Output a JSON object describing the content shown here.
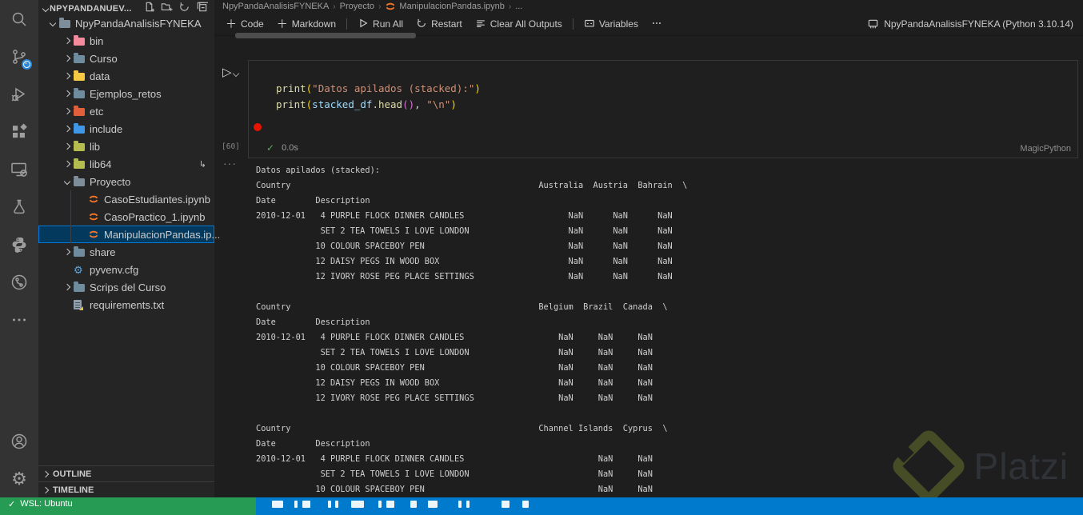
{
  "window": {
    "watermark_text": "Platzi"
  },
  "colors": {
    "accent_blue": "#007acc",
    "selection_bg": "#04395e",
    "selection_border": "#0078d4",
    "jupyter_orange": "#f37626",
    "remote_green": "#259b53",
    "breakpoint_red": "#e51400"
  },
  "activity_bar": {
    "icons": [
      "search",
      "source-control",
      "run-and-debug",
      "extensions",
      "remote-explorer",
      "testing",
      "python",
      "gitlens",
      "more-views",
      "account",
      "settings"
    ],
    "source_control_badge": "pending-clock"
  },
  "sidebar": {
    "header": {
      "title": "NPYPANDANUEV...",
      "actions": [
        "new-file",
        "new-folder",
        "refresh-explorer",
        "collapse-folders"
      ]
    },
    "tree": [
      {
        "label": "NpyPandaAnalisisFYNEKA",
        "type": "folder",
        "color": "#7d8d99",
        "level": 0,
        "expanded": true
      },
      {
        "label": "bin",
        "type": "folder",
        "color": "#f48b9d",
        "level": 1
      },
      {
        "label": "Curso",
        "type": "folder",
        "color": "#6f8b9e",
        "level": 1
      },
      {
        "label": "data",
        "type": "folder",
        "color": "#f6c944",
        "level": 1
      },
      {
        "label": "Ejemplos_retos",
        "type": "folder",
        "color": "#6f8b9e",
        "level": 1
      },
      {
        "label": "etc",
        "type": "folder",
        "color": "#e25f3b",
        "level": 1
      },
      {
        "label": "include",
        "type": "folder",
        "color": "#3f97e8",
        "level": 1
      },
      {
        "label": "lib",
        "type": "folder",
        "color": "#b4bd4e",
        "level": 1
      },
      {
        "label": "lib64",
        "type": "folder",
        "color": "#b4bd4e",
        "level": 1,
        "badge": "symlink"
      },
      {
        "label": "Proyecto",
        "type": "folder",
        "color": "#7d8d99",
        "level": 1,
        "expanded": true
      },
      {
        "label": "CasoEstudiantes.ipynb",
        "type": "notebook",
        "level": 2
      },
      {
        "label": "CasoPractico_1.ipynb",
        "type": "notebook",
        "level": 2
      },
      {
        "label": "ManipulacionPandas.ip...",
        "type": "notebook",
        "level": 2,
        "selected": true
      },
      {
        "label": "share",
        "type": "folder",
        "color": "#6f8b9e",
        "level": 1
      },
      {
        "label": "pyvenv.cfg",
        "type": "gear-file",
        "level": 1
      },
      {
        "label": "Scrips del Curso",
        "type": "folder",
        "color": "#6f8b9e",
        "level": 1
      },
      {
        "label": "requirements.txt",
        "type": "text-file",
        "level": 1
      }
    ],
    "panels": [
      {
        "label": "OUTLINE"
      },
      {
        "label": "TIMELINE"
      }
    ]
  },
  "editor": {
    "breadcrumb": {
      "items": [
        {
          "label": "NpyPandaAnalisisFYNEKA"
        },
        {
          "label": "Proyecto"
        },
        {
          "label": "ManipulacionPandas.ipynb",
          "icon": "jupyter"
        },
        {
          "label": "..."
        }
      ]
    },
    "toolbar": {
      "buttons": [
        {
          "icon": "add",
          "label": "Code"
        },
        {
          "icon": "add",
          "label": "Markdown"
        },
        {
          "icon": "sep",
          "label": ""
        },
        {
          "icon": "run-all",
          "label": "Run All"
        },
        {
          "icon": "restart",
          "label": "Restart"
        },
        {
          "icon": "clear-all",
          "label": "Clear All Outputs"
        },
        {
          "icon": "sep",
          "label": ""
        },
        {
          "icon": "variables",
          "label": "Variables"
        },
        {
          "icon": "more",
          "label": ""
        }
      ],
      "kernel_label": "NpyPandaAnalisisFYNEKA (Python 3.10.14)"
    },
    "cell": {
      "execution_count": "[60]",
      "exec_status_time": "0.0s",
      "language_mode": "MagicPython",
      "code_lines": [
        [
          {
            "t": "print",
            "c": "fn"
          },
          {
            "t": "(",
            "c": "b1"
          },
          {
            "t": "\"Datos apilados (stacked):\"",
            "c": "str"
          },
          {
            "t": ")",
            "c": "b1"
          }
        ],
        [
          {
            "t": "print",
            "c": "fn"
          },
          {
            "t": "(",
            "c": "b1"
          },
          {
            "t": "stacked_df",
            "c": "var"
          },
          {
            "t": ".",
            "c": "pun"
          },
          {
            "t": "head",
            "c": "fn"
          },
          {
            "t": "(",
            "c": "b2"
          },
          {
            "t": ")",
            "c": "b2"
          },
          {
            "t": ", ",
            "c": "pun"
          },
          {
            "t": "\"\\n\"",
            "c": "str"
          },
          {
            "t": ")",
            "c": "b1"
          }
        ]
      ]
    },
    "output": {
      "blocks": [
        {
          "title": "Datos apilados (stacked):",
          "header_left": "Country",
          "index_headers": [
            "Date",
            "Description"
          ],
          "date": "2010-12-01",
          "countries": [
            "Australia",
            "Austria",
            "Bahrain"
          ],
          "descriptions": [
            " 4 PURPLE FLOCK DINNER CANDLES",
            " SET 2 TEA TOWELS I LOVE LONDON",
            "10 COLOUR SPACEBOY PEN",
            "12 DAISY PEGS IN WOOD BOX",
            "12 IVORY ROSE PEG PLACE SETTINGS"
          ],
          "value_text": "NaN"
        },
        {
          "header_left": "Country",
          "index_headers": [
            "Date",
            "Description"
          ],
          "date": "2010-12-01",
          "countries": [
            "Belgium",
            "Brazil",
            "Canada"
          ],
          "descriptions": [
            " 4 PURPLE FLOCK DINNER CANDLES",
            " SET 2 TEA TOWELS I LOVE LONDON",
            "10 COLOUR SPACEBOY PEN",
            "12 DAISY PEGS IN WOOD BOX",
            "12 IVORY ROSE PEG PLACE SETTINGS"
          ],
          "value_text": "NaN"
        },
        {
          "header_left": "Country",
          "index_headers": [
            "Date",
            "Description"
          ],
          "date": "2010-12-01",
          "countries": [
            "Channel Islands",
            "Cyprus"
          ],
          "descriptions": [
            " 4 PURPLE FLOCK DINNER CANDLES",
            " SET 2 TEA TOWELS I LOVE LONDON",
            "10 COLOUR SPACEBOY PEN"
          ],
          "value_text": "NaN"
        }
      ]
    }
  },
  "status_bar": {
    "remote_check": "✓",
    "remote_label": "WSL: Ubuntu",
    "icons": [
      "source-branch",
      "sync",
      "errors",
      "warnings"
    ]
  }
}
